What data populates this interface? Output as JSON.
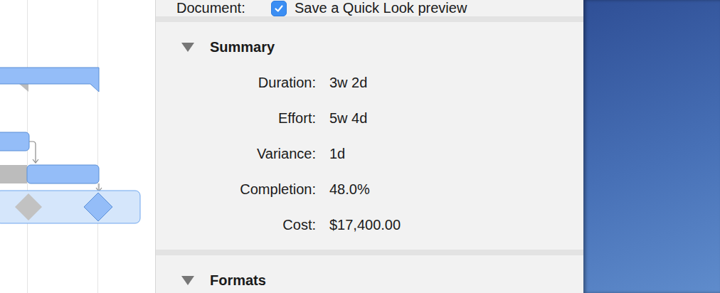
{
  "gantt": {
    "rows": [
      {
        "kind": "summary",
        "selected": false
      },
      {
        "kind": "task",
        "selected": false
      },
      {
        "kind": "task",
        "selected": false
      },
      {
        "kind": "milestone",
        "selected": true
      }
    ]
  },
  "inspector": {
    "document": {
      "label": "Document:",
      "checkbox": {
        "label": "Save a Quick Look preview",
        "checked": true
      }
    },
    "sections": [
      {
        "title": "Summary",
        "expanded": true,
        "fields": [
          {
            "label": "Duration:",
            "value": "3w 2d"
          },
          {
            "label": "Effort:",
            "value": "5w 4d"
          },
          {
            "label": "Variance:",
            "value": "1d"
          },
          {
            "label": "Completion:",
            "value": "48.0%"
          },
          {
            "label": "Cost:",
            "value": "$17,400.00"
          }
        ]
      },
      {
        "title": "Formats",
        "expanded": true,
        "fields": []
      }
    ]
  }
}
